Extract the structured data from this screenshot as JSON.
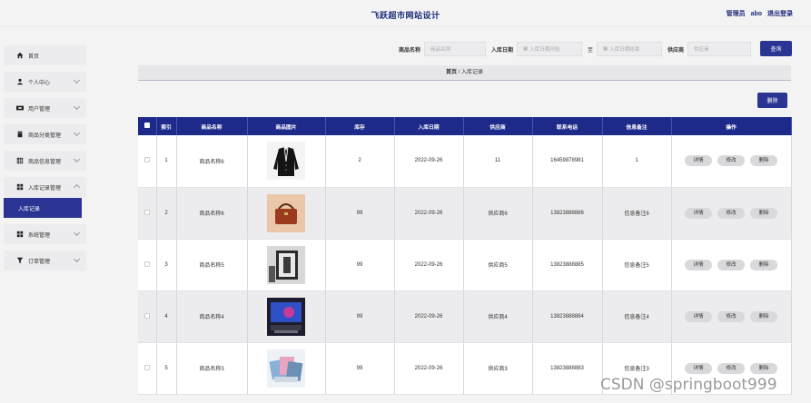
{
  "header": {
    "title": "飞跃超市网站设计",
    "user_role": "管理员",
    "user_name": "abo",
    "logout": "退出登录"
  },
  "sidebar": {
    "items": [
      {
        "label": "首页",
        "icon": "home-icon",
        "chevron": false
      },
      {
        "label": "个人中心",
        "icon": "user-icon",
        "chevron": true
      },
      {
        "label": "用户管理",
        "icon": "users-icon",
        "chevron": true
      },
      {
        "label": "商品分类管理",
        "icon": "trash-icon",
        "chevron": true
      },
      {
        "label": "商品信息管理",
        "icon": "grid-icon",
        "chevron": true
      },
      {
        "label": "入库记录管理",
        "icon": "apps-icon",
        "chevron": true,
        "expanded": true
      },
      {
        "label": "系统管理",
        "icon": "apps-icon",
        "chevron": true
      },
      {
        "label": "订单管理",
        "icon": "funnel-icon",
        "chevron": true
      }
    ],
    "sub_item": "入库记录"
  },
  "search": {
    "name_label": "商品名称",
    "name_placeholder": "商品名称",
    "date_label": "入库日期",
    "date_start_placeholder": "入库日期开始",
    "to": "至",
    "date_end_placeholder": "入库日期结束",
    "supplier_label": "供应商",
    "supplier_placeholder": "供应商",
    "query_button": "查询"
  },
  "breadcrumb": {
    "home": "首页",
    "sep": "/",
    "current": "入库记录"
  },
  "delete_button": "删除",
  "table": {
    "headers": [
      "索引",
      "商品名称",
      "商品图片",
      "库存",
      "入库日期",
      "供应商",
      "联系电话",
      "信息备注",
      "操作"
    ],
    "rows": [
      {
        "index": "1",
        "name": "商品名称6",
        "image": "jacket",
        "stock": "2",
        "date": "2022-09-26",
        "supplier": "11",
        "phone": "16459878981",
        "note": "1"
      },
      {
        "index": "2",
        "name": "商品名称6",
        "image": "handbag",
        "stock": "99",
        "date": "2022-09-26",
        "supplier": "供应商6",
        "phone": "13823888886",
        "note": "信息备注6"
      },
      {
        "index": "3",
        "name": "商品名称5",
        "image": "frame",
        "stock": "99",
        "date": "2022-09-26",
        "supplier": "供应商5",
        "phone": "13823888885",
        "note": "信息备注5"
      },
      {
        "index": "4",
        "name": "商品名称4",
        "image": "tv",
        "stock": "99",
        "date": "2022-09-26",
        "supplier": "供应商4",
        "phone": "13823888884",
        "note": "信息备注4"
      },
      {
        "index": "5",
        "name": "商品名称3",
        "image": "photos",
        "stock": "99",
        "date": "2022-09-26",
        "supplier": "供应商3",
        "phone": "13823888883",
        "note": "信息备注3"
      }
    ],
    "actions": {
      "detail": "详情",
      "edit": "修改",
      "delete": "删除"
    }
  },
  "watermark": "CSDN @springboot999",
  "colors": {
    "primary": "#2a3593",
    "header_row": "#1e2a8a",
    "title": "#1e2a78"
  }
}
